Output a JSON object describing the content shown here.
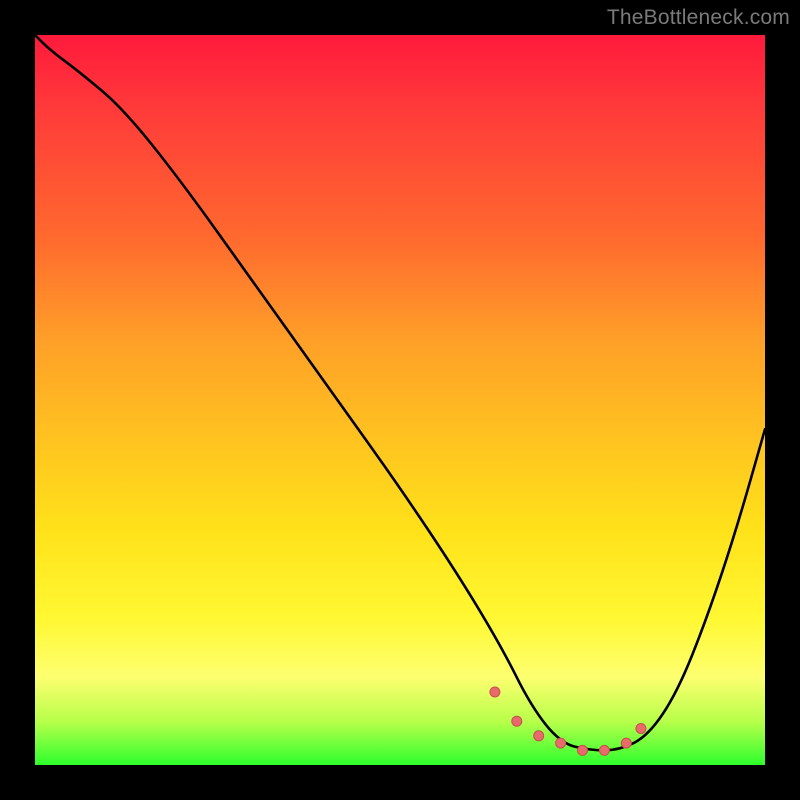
{
  "watermark": "TheBottleneck.com",
  "colors": {
    "frame_bg": "#000000",
    "gradient_top": "#ff1a3c",
    "gradient_mid": "#ffe21a",
    "gradient_bottom": "#2eff2e",
    "curve_stroke": "#000000",
    "marker_fill": "#e96a6a",
    "marker_stroke": "#c94f4f"
  },
  "chart_data": {
    "type": "line",
    "title": "",
    "xlabel": "",
    "ylabel": "",
    "xlim": [
      0,
      100
    ],
    "ylim": [
      0,
      100
    ],
    "grid": false,
    "notes": "V-shaped bottleneck curve on a vertical heat gradient. Lower y = better (green). Curve descends steeply from top-left to a flat minimum around x≈70–82 at y≈2, then rises toward the right edge. Small salmon markers trace the bottom of the valley.",
    "series": [
      {
        "name": "bottleneck-curve",
        "x": [
          0,
          2,
          6,
          12,
          20,
          30,
          40,
          50,
          58,
          64,
          68,
          72,
          76,
          80,
          84,
          88,
          92,
          96,
          100
        ],
        "values": [
          100,
          98,
          95,
          90,
          80,
          66,
          52,
          38,
          26,
          16,
          8,
          3,
          2,
          2,
          4,
          10,
          20,
          32,
          46
        ]
      },
      {
        "name": "valley-markers",
        "x": [
          63,
          66,
          69,
          72,
          75,
          78,
          81,
          83
        ],
        "values": [
          10,
          6,
          4,
          3,
          2,
          2,
          3,
          5
        ]
      }
    ]
  }
}
